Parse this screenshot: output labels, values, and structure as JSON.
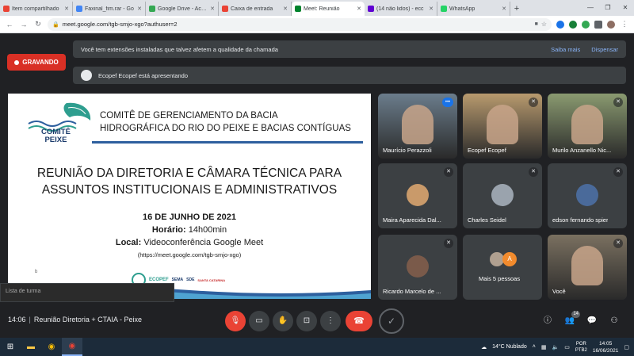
{
  "browser": {
    "tabs": [
      {
        "label": "Item compartilhado",
        "color": "#ea4335",
        "icon": "gmail-icon"
      },
      {
        "label": "Faxinal_fim.rar - Go",
        "color": "#4285f4",
        "icon": "drive-icon"
      },
      {
        "label": "Google Drive - Acess",
        "color": "#34a853",
        "icon": "drive-icon"
      },
      {
        "label": "Caixa de entrada",
        "color": "#ea4335",
        "icon": "gmail-icon"
      },
      {
        "label": "Meet: Reunião",
        "color": "#00832d",
        "icon": "meet-icon",
        "active": true
      },
      {
        "label": "(14 não lidos) - ecc",
        "color": "#6001d2",
        "icon": "yahoo-icon"
      },
      {
        "label": "WhatsApp",
        "color": "#25d366",
        "icon": "whatsapp-icon"
      }
    ],
    "url": "meet.google.com/tgb-smjo-xgo?authuser=2"
  },
  "meet": {
    "recording_label": "GRAVANDO",
    "warning": {
      "text": "Você tem extensões instaladas que talvez afetem a qualidade da chamada",
      "learn_more": "Saiba mais",
      "dismiss": "Dispensar"
    },
    "presenting": "Ecopef Ecopef está apresentando",
    "slide": {
      "logo_text_1": "COMITÊ",
      "logo_text_2": "PEIXE",
      "org_line_1": "COMITÊ DE GERENCIAMENTO DA BACIA",
      "org_line_2": "HIDROGRÁFICA DO RIO DO PEIXE E BACIAS CONTÍGUAS",
      "title_line_1": "REUNIÃO DA DIRETORIA E CÂMARA TÉCNICA PARA",
      "title_line_2": "ASSUNTOS INSTITUCIONAIS E ADMINISTRATIVOS",
      "date": "16 DE JUNHO DE 2021",
      "time_label": "Horário:",
      "time_value": "14h00min",
      "local_label": "Local:",
      "local_value": "Videoconferência Google Meet",
      "link": "(https://meet.google.com/tgb-smjo-xgo)",
      "stray": "b",
      "sponsors": [
        "ECOPEF",
        "SEMA",
        "SDE",
        "SANTA CATARINA"
      ]
    },
    "participants": [
      {
        "name": "Maurício Perazzoli",
        "type": "video",
        "bg": "#6b7d8c",
        "speaking": true
      },
      {
        "name": "Ecopef Ecopef",
        "type": "video",
        "bg": "#b89a6e"
      },
      {
        "name": "Murilo Anzanello Nic...",
        "type": "video",
        "bg": "#8a9a70"
      },
      {
        "name": "Maira Aparecida Dal...",
        "type": "avatar",
        "color": "#c99a6a"
      },
      {
        "name": "Charles Seidel",
        "type": "avatar",
        "color": "#9aa3ad"
      },
      {
        "name": "edson fernando spier",
        "type": "avatar",
        "color": "#4a6a9a"
      },
      {
        "name": "Ricardo Marcelo de ...",
        "type": "avatar",
        "color": "#7a5a4a"
      },
      {
        "name": "Mais 5 pessoas",
        "type": "more",
        "initial": "A"
      },
      {
        "name": "Você",
        "type": "video",
        "bg": "#7a7060"
      }
    ],
    "bottom": {
      "time": "14:06",
      "meeting_name": "Reunião Diretoria + CTAIA - Peixe",
      "people_count": "14"
    },
    "tooltip": "Lista de turma"
  },
  "taskbar": {
    "weather": "14°C  Nublado",
    "lang_1": "POR",
    "lang_2": "PTB2",
    "clock_time": "14:05",
    "clock_date": "16/06/2021"
  }
}
